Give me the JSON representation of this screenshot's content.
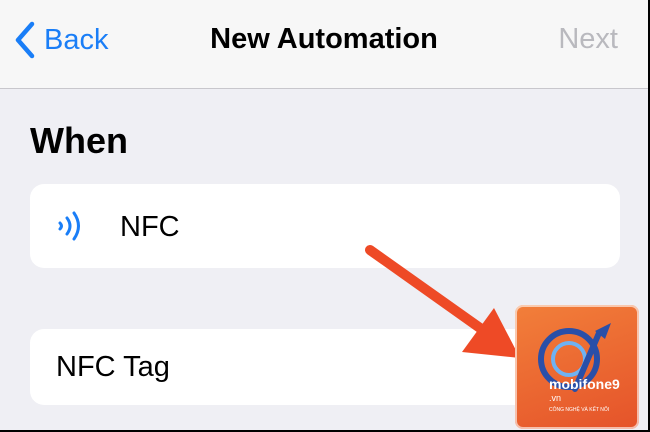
{
  "navbar": {
    "back_label": "Back",
    "title": "New Automation",
    "next_label": "Next"
  },
  "section": {
    "title": "When"
  },
  "nfc_row": {
    "label": "NFC",
    "icon": "nfc-waves-icon"
  },
  "nfc_tag_row": {
    "label": "NFC Tag"
  },
  "annotation": {
    "arrow_color": "#ee4a26"
  },
  "watermark": {
    "brand": "mobifone9",
    "domain": ".vn",
    "tagline": "CÔNG NGHỆ VÀ KẾT NỐI"
  },
  "colors": {
    "accent": "#1a7ef7",
    "disabled": "#b9b9be",
    "background": "#efeff4"
  }
}
